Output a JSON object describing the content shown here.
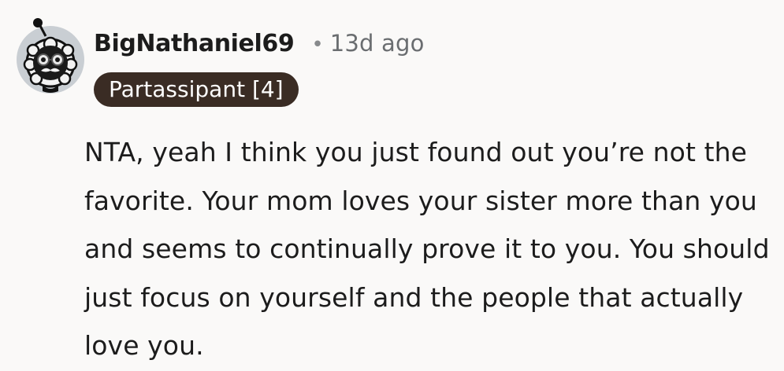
{
  "comment": {
    "author": "BigNathaniel69",
    "separator": "•",
    "timestamp": "13d ago",
    "flair": "Partassipant [4]",
    "body": "NTA, yeah I think you just found out you’re not the favorite. Your mom loves your sister more than you and seems to continually prove it to you. You should just focus on yourself and the people that actually love you.",
    "avatar_icon": "snoo-avatar-icon"
  },
  "colors": {
    "background": "#faf9f8",
    "flair_background": "#3a2c24",
    "flair_text": "#ffffff",
    "timestamp": "#6a6d70",
    "avatar_circle": "#c8cdd2"
  }
}
